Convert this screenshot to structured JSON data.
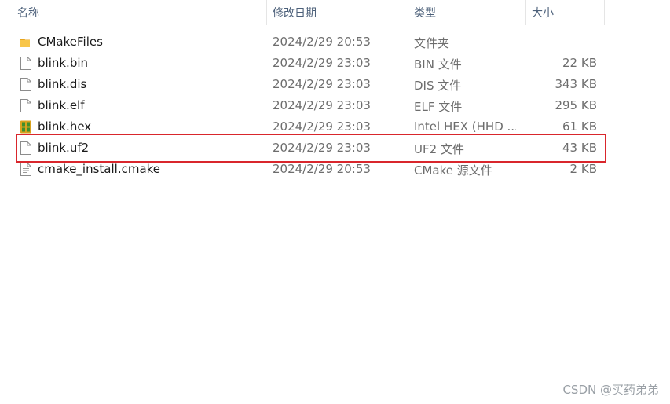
{
  "columns": {
    "name": "名称",
    "date": "修改日期",
    "type": "类型",
    "size": "大小"
  },
  "files": [
    {
      "name": "CMakeFiles",
      "date": "2024/2/29 20:53",
      "type": "文件夹",
      "size": "",
      "icon": "folder-icon"
    },
    {
      "name": "blink.bin",
      "date": "2024/2/29 23:03",
      "type": "BIN 文件",
      "size": "22 KB",
      "icon": "file-icon"
    },
    {
      "name": "blink.dis",
      "date": "2024/2/29 23:03",
      "type": "DIS 文件",
      "size": "343 KB",
      "icon": "file-icon"
    },
    {
      "name": "blink.elf",
      "date": "2024/2/29 23:03",
      "type": "ELF 文件",
      "size": "295 KB",
      "icon": "file-icon"
    },
    {
      "name": "blink.hex",
      "date": "2024/2/29 23:03",
      "type": "Intel HEX (HHD ...",
      "size": "61 KB",
      "icon": "hex-file-icon"
    },
    {
      "name": "blink.uf2",
      "date": "2024/2/29 23:03",
      "type": "UF2 文件",
      "size": "43 KB",
      "icon": "file-icon"
    },
    {
      "name": "cmake_install.cmake",
      "date": "2024/2/29 20:53",
      "type": "CMake 源文件",
      "size": "2 KB",
      "icon": "text-file-icon"
    }
  ],
  "highlight_color": "#d9262c",
  "watermark": "CSDN @买药弟弟"
}
